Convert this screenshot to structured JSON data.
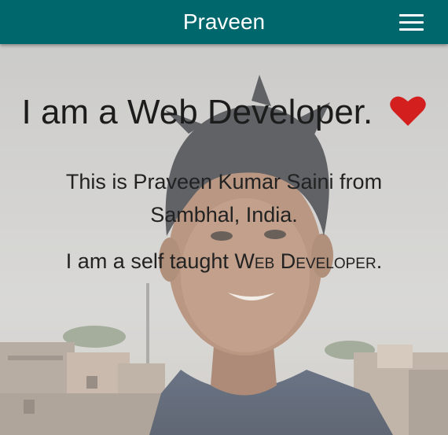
{
  "appbar": {
    "title": "Praveen",
    "menu_icon": "hamburger-menu-icon",
    "color": "#00686c"
  },
  "hero": {
    "heading": "I am a Web Developer.",
    "heart_icon": "heart-icon",
    "heart_color": "#d41f1f",
    "intro": "This is Praveen Kumar Saini from Sambhal, India.",
    "self_taught_prefix": "I am a self taught ",
    "self_taught_emphasis": "Web Developer",
    "self_taught_suffix": "."
  }
}
